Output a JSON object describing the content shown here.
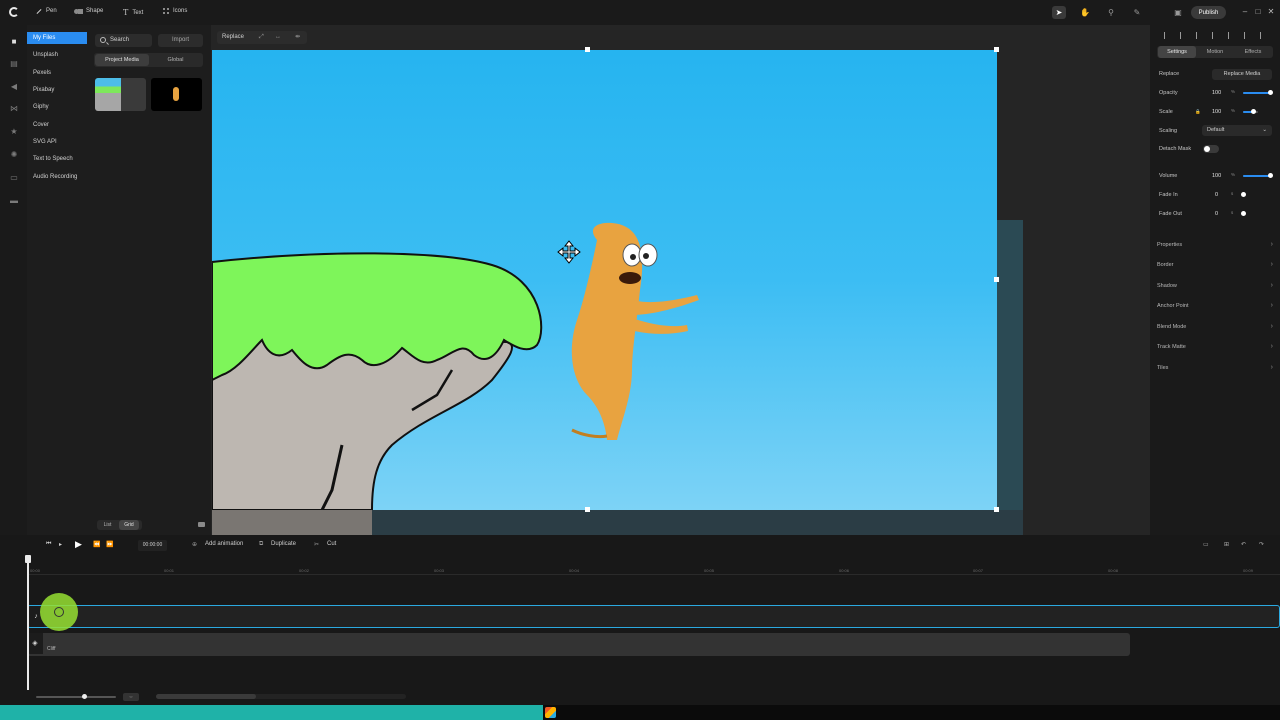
{
  "toolbar": {
    "pen": "Pen",
    "shape": "Shape",
    "text": "Text",
    "icons": "Icons",
    "publish": "Publish"
  },
  "sources": [
    "My Files",
    "Unsplash",
    "Pexels",
    "Pixabay",
    "Giphy",
    "Cover",
    "SVG API",
    "Text to Speech",
    "Audio Recording"
  ],
  "media": {
    "search": "Search",
    "import": "Import",
    "tab_project": "Project Media",
    "tab_global": "Global",
    "view_list": "List",
    "view_grid": "Grid"
  },
  "canvas": {
    "replace": "Replace"
  },
  "props": {
    "tab_settings": "Settings",
    "tab_motion": "Motion",
    "tab_effects": "Effects",
    "replace_label": "Replace",
    "replace_media": "Replace Media",
    "opacity_label": "Opacity",
    "opacity": "100",
    "opacity_level": 100,
    "scale_label": "Scale",
    "scale": "100",
    "scale_level": 70,
    "scaling_label": "Scaling",
    "scaling": "Default",
    "detach_mask": "Detach Mask",
    "volume_label": "Volume",
    "volume": "100",
    "volume_level": 100,
    "fade_in_label": "Fade In",
    "fade_in": "0",
    "fade_out_label": "Fade Out",
    "fade_out": "0",
    "unit_pct": "%",
    "unit_s": "s",
    "sections": [
      "Properties",
      "Border",
      "Shadow",
      "Anchor Point",
      "Blend Mode",
      "Track Matte",
      "Tiles"
    ]
  },
  "timeline": {
    "timecode": "00:00:00",
    "add_animation": "Add animation",
    "duplicate": "Duplicate",
    "cut": "Cut",
    "ticks": [
      "00:00",
      "00:01",
      "00:02",
      "00:03",
      "00:04",
      "00:05",
      "00:06",
      "00:07",
      "00:08",
      "00:09"
    ],
    "track2_label": "Cliff"
  },
  "colors": {
    "accent": "#2a8cf0",
    "sky": "#26b4f0",
    "grass": "#7ef55a",
    "character": "#e8a340"
  }
}
